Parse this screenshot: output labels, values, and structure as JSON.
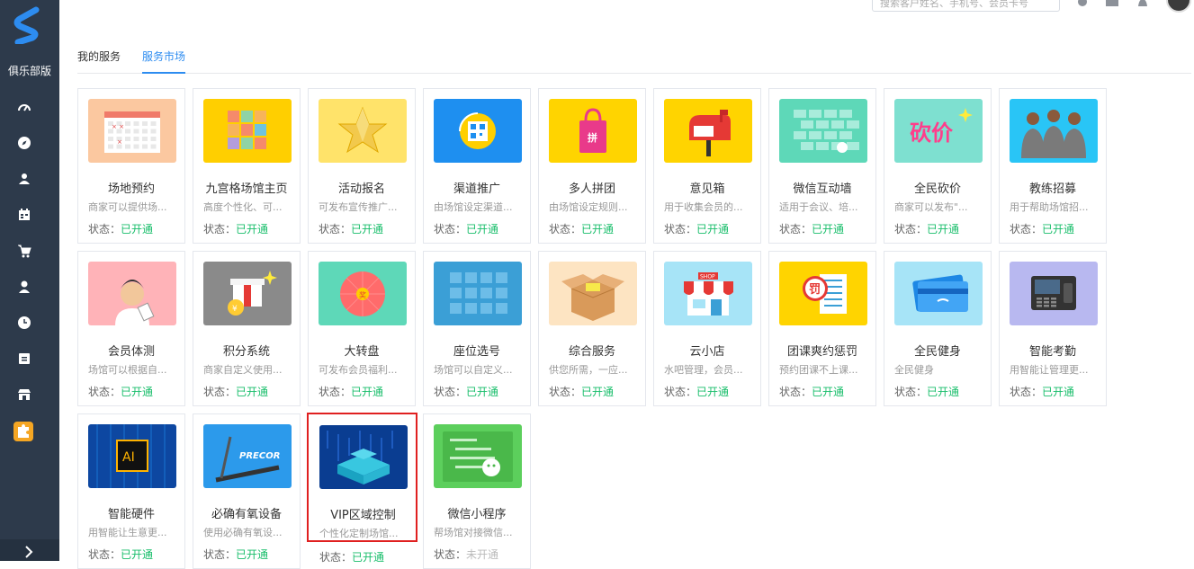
{
  "sidebar": {
    "club_label": "俱乐部版",
    "items": [
      {
        "icon": "dashboard-icon"
      },
      {
        "icon": "compass-icon"
      },
      {
        "icon": "members-icon"
      },
      {
        "icon": "calendar-icon"
      },
      {
        "icon": "cart-icon"
      },
      {
        "icon": "user-icon"
      },
      {
        "icon": "clock-icon"
      },
      {
        "icon": "archive-icon"
      },
      {
        "icon": "store-icon"
      },
      {
        "icon": "puzzle-icon",
        "active": true
      }
    ],
    "expand_icon": "chevron-right-icon",
    "accent_color": "#f5a623",
    "bg_color": "#2d3a4b"
  },
  "header": {
    "search_placeholder": "搜索客户姓名、手机号、会员卡号",
    "icons": [
      "settings-icon",
      "mail-icon",
      "bell-icon"
    ]
  },
  "tabs": [
    {
      "label": "我的服务",
      "active": false
    },
    {
      "label": "服务市场",
      "active": true
    }
  ],
  "status_prefix": "状态：",
  "services": [
    {
      "title": "场地预约",
      "desc": "商家可以提供场...",
      "status": "已开通",
      "enabled": true
    },
    {
      "title": "九宫格场馆主页",
      "desc": "高度个性化、可...",
      "status": "已开通",
      "enabled": true
    },
    {
      "title": "活动报名",
      "desc": "可发布宣传推广...",
      "status": "已开通",
      "enabled": true
    },
    {
      "title": "渠道推广",
      "desc": "由场馆设定渠道...",
      "status": "已开通",
      "enabled": true
    },
    {
      "title": "多人拼团",
      "desc": "由场馆设定规则...",
      "status": "已开通",
      "enabled": true
    },
    {
      "title": "意见箱",
      "desc": "用于收集会员的...",
      "status": "已开通",
      "enabled": true
    },
    {
      "title": "微信互动墙",
      "desc": "适用于会议、培...",
      "status": "已开通",
      "enabled": true
    },
    {
      "title": "全民砍价",
      "desc": "商家可以发布\"...",
      "status": "已开通",
      "enabled": true
    },
    {
      "title": "教练招募",
      "desc": "用于帮助场馆招...",
      "status": "已开通",
      "enabled": true
    },
    {
      "title": "会员体测",
      "desc": "场馆可以根据自...",
      "status": "已开通",
      "enabled": true
    },
    {
      "title": "积分系统",
      "desc": "商家自定义使用...",
      "status": "已开通",
      "enabled": true
    },
    {
      "title": "大转盘",
      "desc": "可发布会员福利...",
      "status": "已开通",
      "enabled": true
    },
    {
      "title": "座位选号",
      "desc": "场馆可以自定义...",
      "status": "已开通",
      "enabled": true
    },
    {
      "title": "综合服务",
      "desc": "供您所需，一应...",
      "status": "已开通",
      "enabled": true
    },
    {
      "title": "云小店",
      "desc": "水吧管理，会员...",
      "status": "已开通",
      "enabled": true
    },
    {
      "title": "团课爽约惩罚",
      "desc": "预约团课不上课...",
      "status": "已开通",
      "enabled": true
    },
    {
      "title": "全民健身",
      "desc": "全民健身",
      "status": "已开通",
      "enabled": true
    },
    {
      "title": "智能考勤",
      "desc": "用智能让管理更...",
      "status": "已开通",
      "enabled": true
    },
    {
      "title": "智能硬件",
      "desc": "用智能让生意更...",
      "status": "已开通",
      "enabled": true
    },
    {
      "title": "必确有氧设备",
      "desc": "使用必确有氧设...",
      "status": "已开通",
      "enabled": true
    },
    {
      "title": "VIP区域控制",
      "desc": "个性化定制场馆...",
      "status": "已开通",
      "enabled": true,
      "highlighted": true
    },
    {
      "title": "微信小程序",
      "desc": "帮场馆对接微信...",
      "status": "未开通",
      "enabled": false
    }
  ],
  "thumb_text": {
    "ai": "AI",
    "precor": "PRECOR",
    "bargain": "砍价",
    "penalty": "罚",
    "shop": "SHOP",
    "wheel": "奖"
  }
}
